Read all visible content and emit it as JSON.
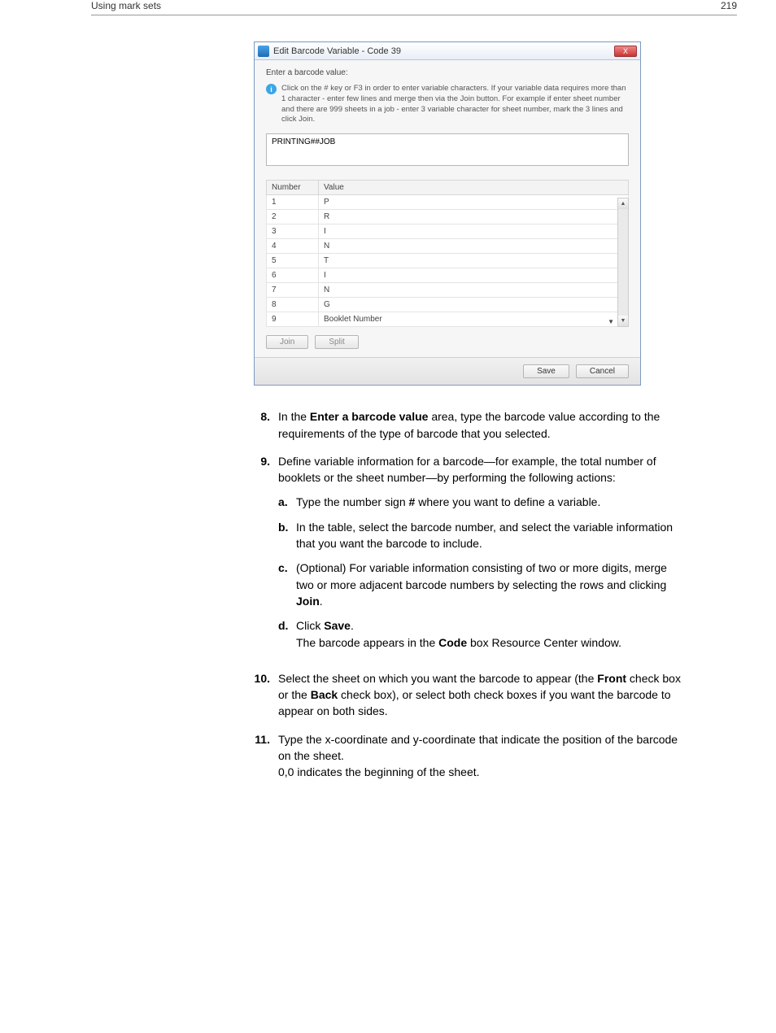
{
  "header": {
    "left": "Using mark sets",
    "right": "219"
  },
  "dialog": {
    "title": "Edit Barcode Variable - Code 39",
    "close": "X",
    "prompt": "Enter a barcode value:",
    "info": "Click on the # key or F3 in order to enter variable characters.\nIf your variable data requires more than 1 character - enter few lines and merge then via the Join button. For example if enter sheet number and there are 999 sheets in a job - enter 3 variable character for sheet number, mark the 3 lines and click Join.",
    "input_value": "PRINTING##JOB",
    "col_number": "Number",
    "col_value": "Value",
    "rows": [
      {
        "n": "1",
        "v": "P"
      },
      {
        "n": "2",
        "v": "R"
      },
      {
        "n": "3",
        "v": "I"
      },
      {
        "n": "4",
        "v": "N"
      },
      {
        "n": "5",
        "v": "T"
      },
      {
        "n": "6",
        "v": "I"
      },
      {
        "n": "7",
        "v": "N"
      },
      {
        "n": "8",
        "v": "G"
      },
      {
        "n": "9",
        "v": "Booklet Number"
      }
    ],
    "join": "Join",
    "split": "Split",
    "save": "Save",
    "cancel": "Cancel"
  },
  "steps": {
    "s8": {
      "n": "8.",
      "pre": "In the ",
      "b1": "Enter a barcode value",
      "post": " area, type the barcode value according to the requirements of the type of barcode that you selected."
    },
    "s9": {
      "n": "9.",
      "t": "Define variable information for a barcode—for example, the total number of booklets or the sheet number—by performing the following actions:"
    },
    "s9a": {
      "l": "a.",
      "pre": "Type the number sign ",
      "b": "#",
      "post": " where you want to define a variable."
    },
    "s9b": {
      "l": "b.",
      "t": "In the table, select the barcode number, and select the variable information that you want the barcode to include."
    },
    "s9c": {
      "l": "c.",
      "pre": "(Optional) For variable information consisting of two or more digits, merge two or more adjacent barcode numbers by selecting the rows and clicking ",
      "b": "Join",
      "post": "."
    },
    "s9d": {
      "l": "d.",
      "pre": "Click ",
      "b": "Save",
      "post": ".",
      "line2a": "The barcode appears in the ",
      "line2b": "Code",
      "line2c": " box Resource Center window."
    },
    "s10": {
      "n": "10.",
      "pre": "Select the sheet on which you want the barcode to appear (the ",
      "b1": "Front",
      "mid": " check box or the ",
      "b2": "Back",
      "post": " check box), or select both check boxes if you want the barcode to appear on both sides."
    },
    "s11": {
      "n": "11.",
      "t1": "Type the x-coordinate and y-coordinate that indicate the position of the barcode on the sheet.",
      "t2": "0,0 indicates the beginning of the sheet."
    }
  }
}
